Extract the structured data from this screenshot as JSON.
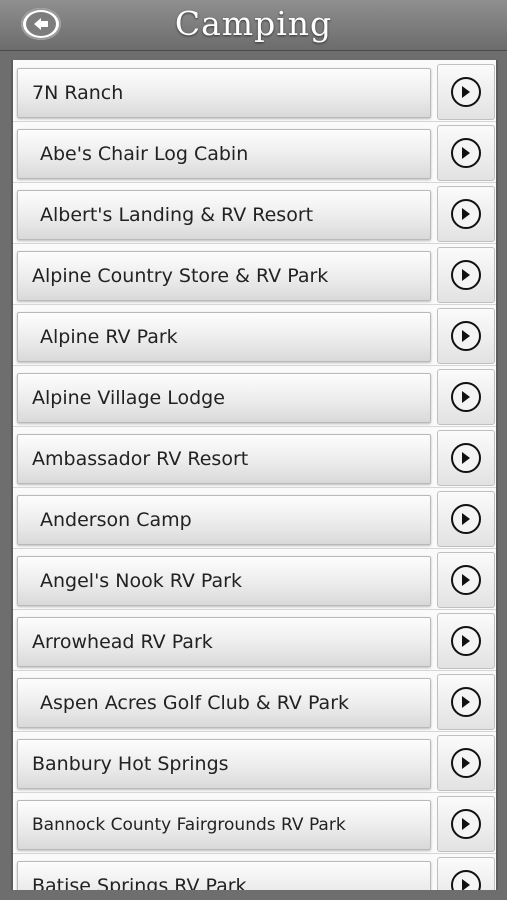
{
  "header": {
    "title": "Camping",
    "back_icon": "back-arrow-icon"
  },
  "items": [
    {
      "label": "7N Ranch",
      "indent": 14
    },
    {
      "label": "Abe's Chair Log Cabin",
      "indent": 22
    },
    {
      "label": "Albert's Landing & RV Resort",
      "indent": 22
    },
    {
      "label": "Alpine Country Store & RV Park",
      "indent": 14
    },
    {
      "label": "Alpine RV Park",
      "indent": 22
    },
    {
      "label": "Alpine Village Lodge",
      "indent": 14
    },
    {
      "label": "Ambassador RV Resort",
      "indent": 14
    },
    {
      "label": "Anderson Camp",
      "indent": 22
    },
    {
      "label": "Angel's Nook RV Park",
      "indent": 22
    },
    {
      "label": "Arrowhead RV Park",
      "indent": 14
    },
    {
      "label": "Aspen Acres Golf Club & RV Park",
      "indent": 22
    },
    {
      "label": "Banbury Hot Springs",
      "indent": 14
    },
    {
      "label": "Bannock County Fairgrounds RV Park",
      "indent": 14,
      "small": true
    },
    {
      "label": "Batise Springs RV Park",
      "indent": 14
    }
  ],
  "colors": {
    "header": "#7a7a7a",
    "list_bg": "#fafafa",
    "text": "#222222"
  },
  "icons": {
    "row_arrow": "chevron-right-circle-icon"
  }
}
